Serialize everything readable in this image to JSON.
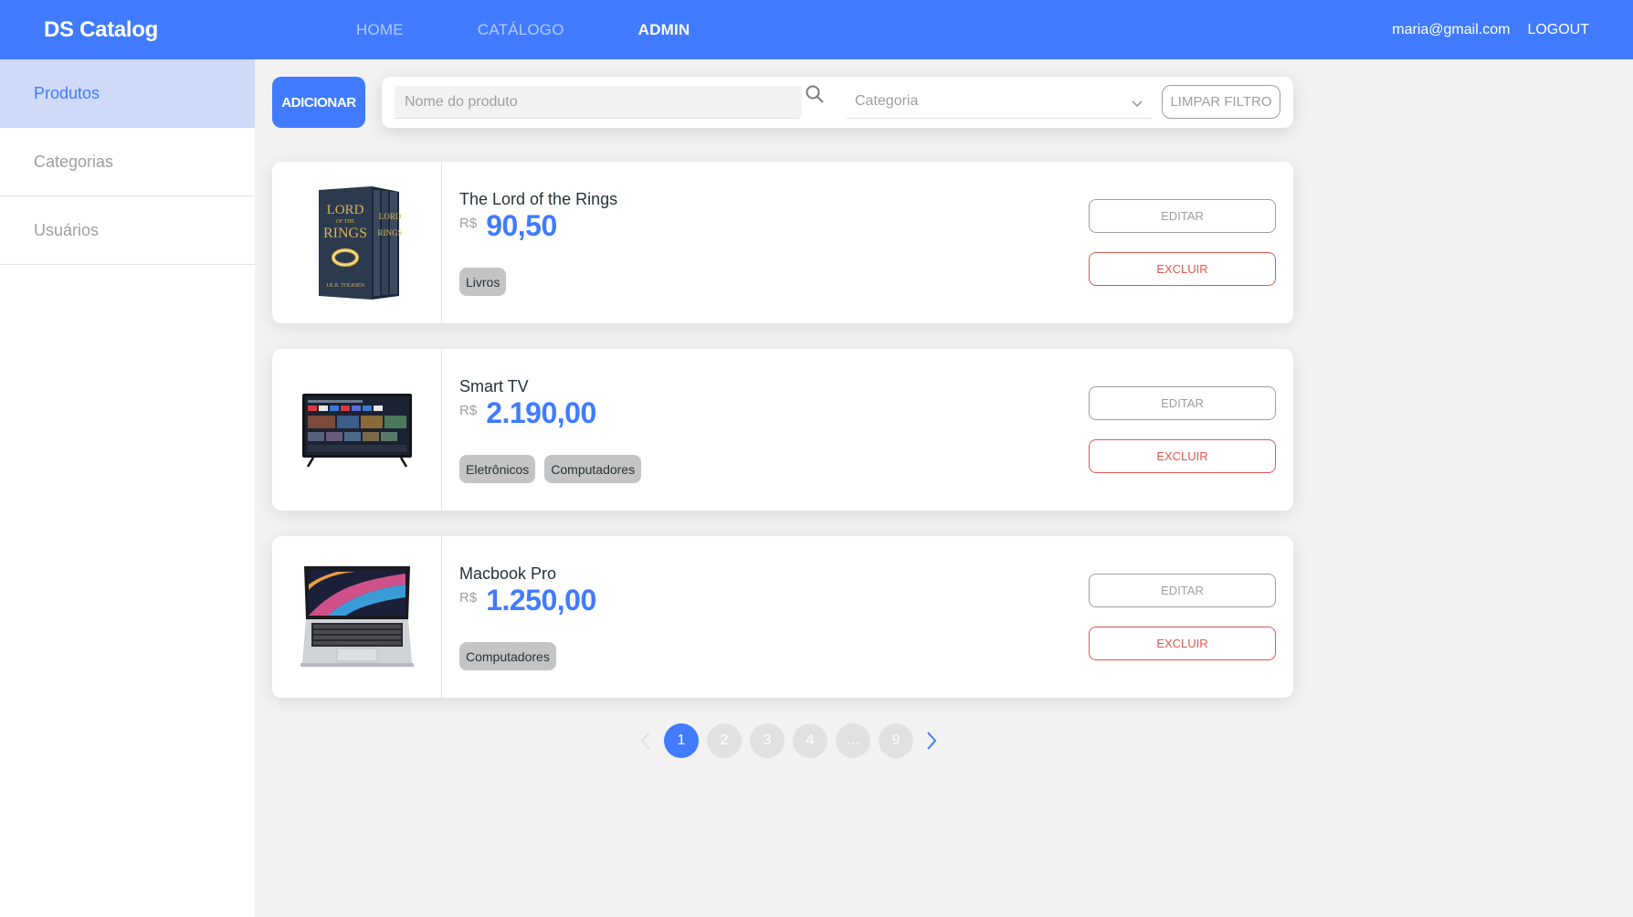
{
  "navbar": {
    "brand": "DS Catalog",
    "links": [
      {
        "label": "HOME",
        "active": false
      },
      {
        "label": "CATÁLOGO",
        "active": false
      },
      {
        "label": "ADMIN",
        "active": true
      }
    ],
    "user_email": "maria@gmail.com",
    "logout_label": "LOGOUT"
  },
  "sidebar": {
    "items": [
      {
        "label": "Produtos",
        "active": true
      },
      {
        "label": "Categorias",
        "active": false
      },
      {
        "label": "Usuários",
        "active": false
      }
    ]
  },
  "toolbar": {
    "add_label": "ADICIONAR",
    "search_placeholder": "Nome do produto",
    "search_value": "",
    "category_placeholder": "Categoria",
    "clear_label": "LIMPAR FILTRO"
  },
  "products": [
    {
      "name": "The Lord of the Rings",
      "currency": "R$",
      "price": "90,50",
      "categories": [
        "Livros"
      ],
      "image_icon": "book-box-set-image",
      "edit_label": "EDITAR",
      "delete_label": "EXCLUIR"
    },
    {
      "name": "Smart TV",
      "currency": "R$",
      "price": "2.190,00",
      "categories": [
        "Eletrônicos",
        "Computadores"
      ],
      "image_icon": "smart-tv-image",
      "edit_label": "EDITAR",
      "delete_label": "EXCLUIR"
    },
    {
      "name": "Macbook Pro",
      "currency": "R$",
      "price": "1.250,00",
      "categories": [
        "Computadores"
      ],
      "image_icon": "laptop-image",
      "edit_label": "EDITAR",
      "delete_label": "EXCLUIR"
    }
  ],
  "pagination": {
    "pages": [
      "1",
      "2",
      "3",
      "4",
      "...",
      "9"
    ],
    "active_page": "1"
  },
  "colors": {
    "primary": "#407bff",
    "background": "#f2f2f2",
    "text_dark": "#263238",
    "text_muted": "#9e9e9e",
    "danger": "#df5753",
    "badge": "#c4c4c4",
    "sidebar_active_bg": "#cfdaf9"
  }
}
